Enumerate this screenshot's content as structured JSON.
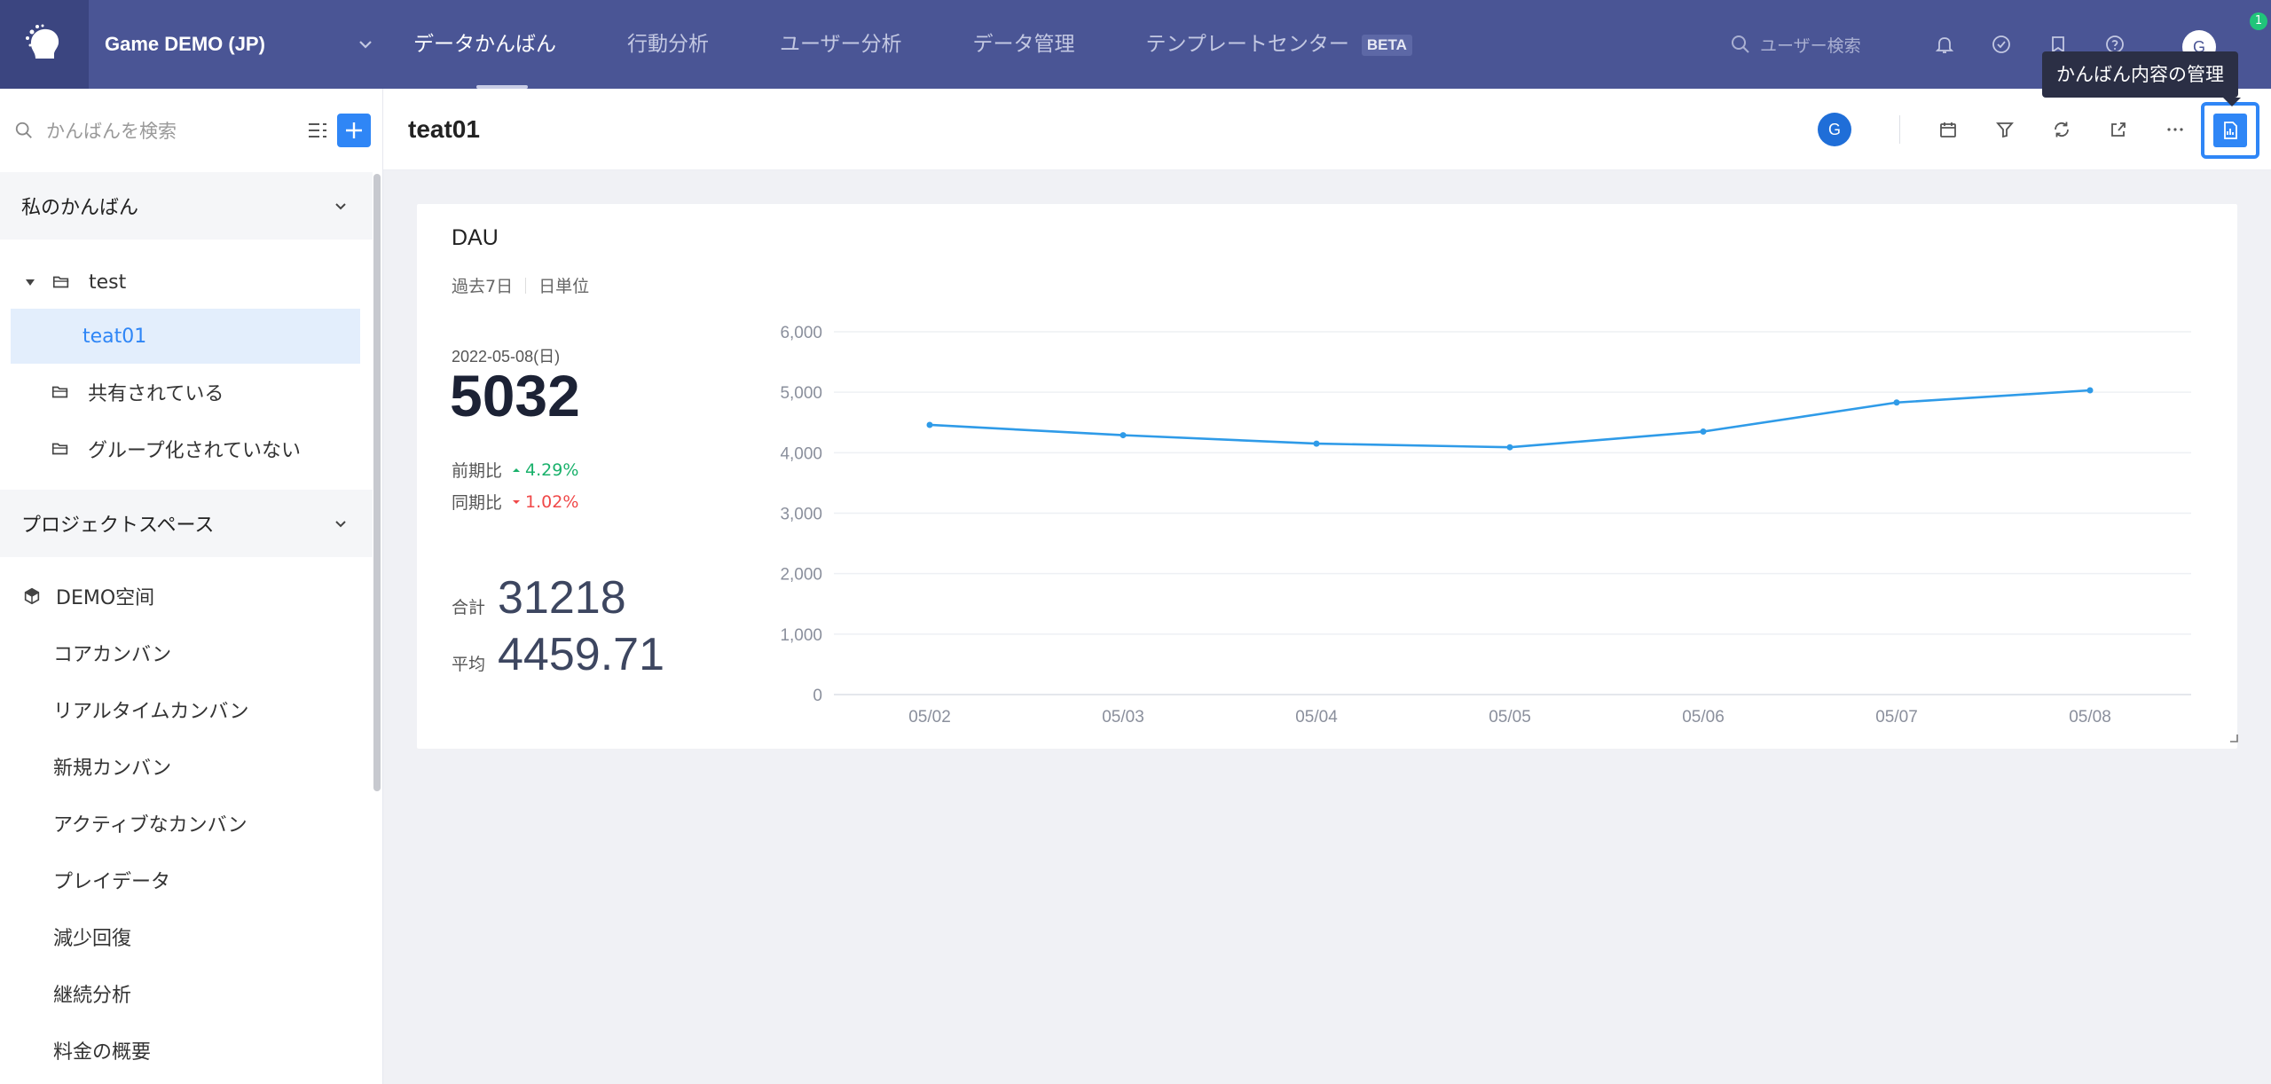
{
  "topbar": {
    "project": "Game DEMO (JP)",
    "nav": [
      {
        "label": "データかんばん",
        "active": true
      },
      {
        "label": "行動分析",
        "active": false
      },
      {
        "label": "ユーザー分析",
        "active": false
      },
      {
        "label": "データ管理",
        "active": false
      },
      {
        "label": "テンプレートセンター",
        "active": false,
        "badge": "BETA"
      }
    ],
    "search_placeholder": "ユーザー検索",
    "avatar": "G",
    "notification_badge": "1",
    "tooltip": "かんばん内容の管理"
  },
  "sidebar": {
    "search_placeholder": "かんばんを検索",
    "my_section": "私のかんばん",
    "folder_test": "test",
    "board_selected": "teat01",
    "shared": "共有されている",
    "ungrouped": "グループ化されていない",
    "project_section": "プロジェクトスペース",
    "space_name": "DEMO空间",
    "space_boards": [
      "コアカンバン",
      "リアルタイムカンバン",
      "新規カンバン",
      "アクティブなカンバン",
      "プレイデータ",
      "減少回復",
      "継続分析",
      "料金の概要"
    ]
  },
  "header": {
    "title": "teat01",
    "user_badge": "G"
  },
  "card": {
    "title": "DAU",
    "range": "過去7日",
    "granularity": "日単位",
    "date": "2022-05-08(日)",
    "value": "5032",
    "prev_label": "前期比",
    "prev_value": "4.29%",
    "yoy_label": "同期比",
    "yoy_value": "1.02%",
    "total_label": "合計",
    "total_value": "31218",
    "avg_label": "平均",
    "avg_value": "4459.71"
  },
  "chart_data": {
    "type": "line",
    "categories": [
      "05/02",
      "05/03",
      "05/04",
      "05/05",
      "05/06",
      "05/07",
      "05/08"
    ],
    "series": [
      {
        "values": [
          4460,
          4290,
          4150,
          4090,
          4350,
          4830,
          5032
        ]
      }
    ],
    "ylim": [
      0,
      6000
    ],
    "yticks": [
      0,
      1000,
      2000,
      3000,
      4000,
      5000,
      6000
    ],
    "ytick_labels": [
      "0",
      "1,000",
      "2,000",
      "3,000",
      "4,000",
      "5,000",
      "6,000"
    ],
    "grid": true,
    "color": "#2f9be8"
  }
}
